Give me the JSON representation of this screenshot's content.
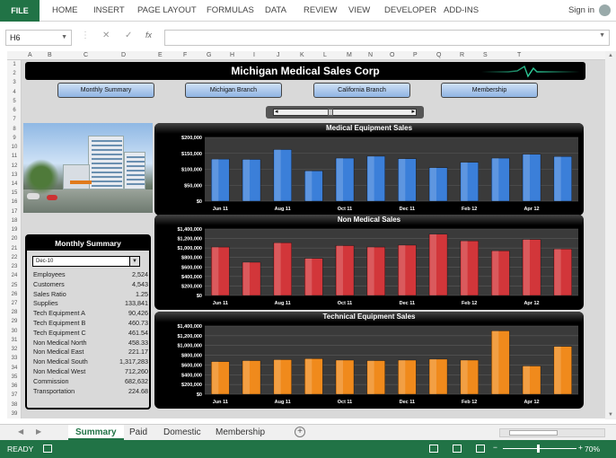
{
  "ribbon": {
    "file": "FILE",
    "tabs": [
      "HOME",
      "INSERT",
      "PAGE LAYOUT",
      "FORMULAS",
      "DATA",
      "REVIEW",
      "VIEW",
      "DEVELOPER",
      "ADD-INS"
    ],
    "signin": "Sign in"
  },
  "formula_bar": {
    "name_box": "H6",
    "fx": "fx",
    "value": ""
  },
  "columns": [
    "A",
    "B",
    "C",
    "D",
    "E",
    "F",
    "G",
    "H",
    "I",
    "J",
    "K",
    "L",
    "M",
    "N",
    "O",
    "P",
    "Q",
    "R",
    "S",
    "T"
  ],
  "rows": [
    "1",
    "2",
    "3",
    "4",
    "5",
    "6",
    "7",
    "8",
    "9",
    "10",
    "11",
    "12",
    "13",
    "14",
    "15",
    "16",
    "17",
    "18",
    "19",
    "20",
    "21",
    "22",
    "23",
    "24",
    "25",
    "26",
    "27",
    "28",
    "29",
    "30",
    "31",
    "32",
    "33",
    "34",
    "35",
    "36",
    "37",
    "38",
    "39"
  ],
  "dashboard": {
    "title": "Michigan Medical Sales Corp",
    "nav": [
      "Monthly Summary",
      "Michigan Branch",
      "California Branch",
      "Membership"
    ]
  },
  "summary": {
    "heading": "Monthly Summary",
    "selected": "Dec-10",
    "rows": [
      {
        "label": "Employees",
        "value": "2,524"
      },
      {
        "label": "Customers",
        "value": "4,543"
      },
      {
        "label": "Sales Ratio",
        "value": "1.25"
      },
      {
        "label": "Supplies",
        "value": "133,841"
      },
      {
        "label": "Tech Equipment A",
        "value": "90,426"
      },
      {
        "label": "Tech Equipment B",
        "value": "460.73"
      },
      {
        "label": "Tech Equipment C",
        "value": "461.54"
      },
      {
        "label": "Non Medical North",
        "value": "458.33"
      },
      {
        "label": "Non Medical East",
        "value": "221.17"
      },
      {
        "label": "Non Medical South",
        "value": "1,317,283"
      },
      {
        "label": "Non Medical West",
        "value": "712,260"
      },
      {
        "label": "Commission",
        "value": "682,632"
      },
      {
        "label": "Transportation",
        "value": "224.68"
      }
    ]
  },
  "chart_data": [
    {
      "type": "bar",
      "title": "Medical Equipment Sales",
      "categories": [
        "Jun 11",
        "Jul 11",
        "Aug 11",
        "Sep 11",
        "Oct 11",
        "Nov 11",
        "Dec 11",
        "Jan 12",
        "Feb 12",
        "Mar 12",
        "Apr 12",
        "May 12"
      ],
      "x_tick_labels": [
        "Jun 11",
        "",
        "Aug 11",
        "",
        "Oct 11",
        "",
        "Dec 11",
        "",
        "Feb 12",
        "",
        "Apr 12",
        ""
      ],
      "values": [
        132000,
        131000,
        162000,
        95000,
        135000,
        141000,
        133000,
        105000,
        122000,
        135000,
        147000,
        140000
      ],
      "y_ticks": [
        "$0",
        "$50,000",
        "$100,000",
        "$150,000",
        "$200,000"
      ],
      "ylim": [
        0,
        200000
      ],
      "color": "#3b7fd9"
    },
    {
      "type": "bar",
      "title": "Non Medical Sales",
      "categories": [
        "Jun 11",
        "Jul 11",
        "Aug 11",
        "Sep 11",
        "Oct 11",
        "Nov 11",
        "Dec 11",
        "Jan 12",
        "Feb 12",
        "Mar 12",
        "Apr 12",
        "May 12"
      ],
      "x_tick_labels": [
        "Jun 11",
        "",
        "Aug 11",
        "",
        "Oct 11",
        "",
        "Dec 11",
        "",
        "Feb 12",
        "",
        "Apr 12",
        ""
      ],
      "values": [
        1020000,
        700000,
        1110000,
        780000,
        1050000,
        1020000,
        1060000,
        1290000,
        1150000,
        940000,
        1180000,
        980000
      ],
      "y_ticks": [
        "$0",
        "$200,000",
        "$400,000",
        "$600,000",
        "$800,000",
        "$1,000,000",
        "$1,200,000",
        "$1,400,000"
      ],
      "ylim": [
        0,
        1400000
      ],
      "color": "#d2363a"
    },
    {
      "type": "bar",
      "title": "Technical Equipment Sales",
      "categories": [
        "Jun 11",
        "Jul 11",
        "Aug 11",
        "Sep 11",
        "Oct 11",
        "Nov 11",
        "Dec 11",
        "Jan 12",
        "Feb 12",
        "Mar 12",
        "Apr 12",
        "May 12"
      ],
      "x_tick_labels": [
        "Jun 11",
        "",
        "Aug 11",
        "",
        "Oct 11",
        "",
        "Dec 11",
        "",
        "Feb 12",
        "",
        "Apr 12",
        ""
      ],
      "values": [
        670000,
        690000,
        710000,
        730000,
        700000,
        690000,
        700000,
        720000,
        700000,
        1300000,
        580000,
        980000
      ],
      "y_ticks": [
        "$0",
        "$200,000",
        "$400,000",
        "$600,000",
        "$800,000",
        "$1,000,000",
        "$1,200,000",
        "$1,400,000"
      ],
      "ylim": [
        0,
        1400000
      ],
      "color": "#f08a1c"
    }
  ],
  "sheet_tabs": [
    "Summary",
    "Paid",
    "Domestic",
    "Membership"
  ],
  "status": {
    "ready": "READY",
    "zoom": "70%"
  }
}
